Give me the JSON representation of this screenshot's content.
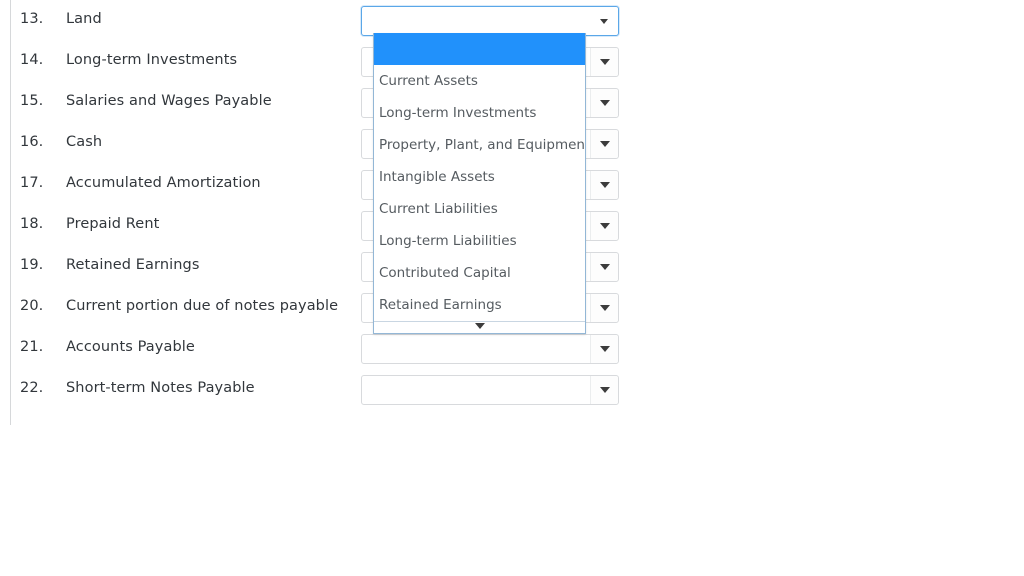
{
  "page": {
    "background_color": "#ffffff",
    "rule_color": "#d6d8da"
  },
  "form": {
    "rows": [
      {
        "number": "13.",
        "label": "Land",
        "select_value": ""
      },
      {
        "number": "14.",
        "label": "Long-term Investments",
        "select_value": ""
      },
      {
        "number": "15.",
        "label": "Salaries and Wages Payable",
        "select_value": ""
      },
      {
        "number": "16.",
        "label": "Cash",
        "select_value": ""
      },
      {
        "number": "17.",
        "label": "Accumulated Amortization",
        "select_value": ""
      },
      {
        "number": "18.",
        "label": "Prepaid Rent",
        "select_value": ""
      },
      {
        "number": "19.",
        "label": "Retained Earnings",
        "select_value": ""
      },
      {
        "number": "20.",
        "label": "Current portion due of notes payable",
        "select_value": ""
      },
      {
        "number": "21.",
        "label": "Accounts Payable",
        "select_value": ""
      },
      {
        "number": "22.",
        "label": "Short-term Notes Payable",
        "select_value": ""
      }
    ]
  },
  "dropdown": {
    "open_for_row": "13.",
    "highlight_color": "#2191fb",
    "border_color": "#93b7d6",
    "has_scroll_down_arrow": true,
    "options": [
      {
        "label": "",
        "selected": true
      },
      {
        "label": "Current Assets",
        "selected": false
      },
      {
        "label": "Long-term Investments",
        "selected": false
      },
      {
        "label": "Property, Plant, and Equipment",
        "selected": false
      },
      {
        "label": "Intangible Assets",
        "selected": false
      },
      {
        "label": "Current Liabilities",
        "selected": false
      },
      {
        "label": "Long-term Liabilities",
        "selected": false
      },
      {
        "label": "Contributed Capital",
        "selected": false
      },
      {
        "label": "Retained Earnings",
        "selected": false
      }
    ]
  },
  "icons": {
    "select_caret": "chevron-down-icon",
    "scroll_down": "scroll-down-arrow-icon"
  }
}
